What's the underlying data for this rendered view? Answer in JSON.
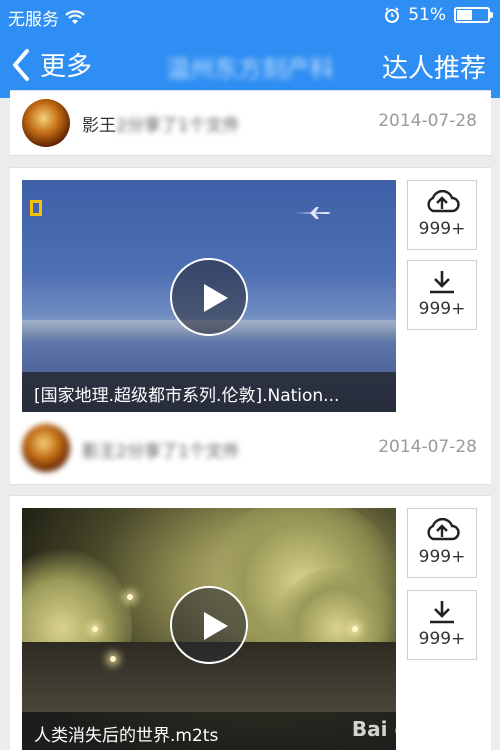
{
  "status_bar": {
    "carrier": "无服务",
    "time": "",
    "battery_percent": "51%",
    "battery_level": 0.51
  },
  "nav": {
    "back_label": "更多",
    "title": "温州东方刻产科",
    "right_label": "达人推荐"
  },
  "cards": [
    {
      "author_prefix": "影王",
      "author_rest": "2分享了1个文件",
      "date": "2014-07-28"
    },
    {
      "video_title": "[国家地理.超级都市系列.伦敦].Nation...",
      "share_count": "999+",
      "download_count": "999+",
      "author_prefix": "",
      "author_rest": "影王2分享了1个文件",
      "date": "2014-07-28"
    },
    {
      "video_title": "人类消失后的世界.m2ts",
      "share_count": "999+",
      "download_count": "999+"
    }
  ],
  "watermark": "Bai du 经验",
  "icons": {
    "wifi": "wifi-icon",
    "alarm": "alarm-icon",
    "back": "chevron-left-icon",
    "share": "cloud-upload-icon",
    "download": "download-icon",
    "play": "play-icon"
  }
}
